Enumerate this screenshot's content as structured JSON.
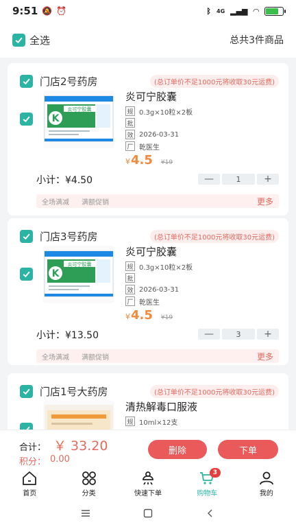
{
  "status": {
    "time": "9:51",
    "network": "4G",
    "battery_level": 0.75
  },
  "select_bar": {
    "label": "全选",
    "total": "总共3件商品"
  },
  "stores": [
    {
      "name": "门店2号药房",
      "freight_note": "(总订单价不足1000元将收取30元运费)",
      "product": {
        "name": "炎可宁胶囊",
        "spec_tag": "规",
        "spec": "0.3g×10粒×2板",
        "approval_tag": "批",
        "approval": "",
        "expiry_tag": "效",
        "expiry": "2026-03-31",
        "maker_tag": "厂",
        "maker": "乾医生",
        "price_symbol": "¥",
        "price": "4.5",
        "original_price": "¥19",
        "box_title": "炎可宁胶囊",
        "box_letter": "K"
      },
      "subtotal": "小计：¥4.50",
      "quantity": "1",
      "promos": [
        "全场满减",
        "满额促销"
      ],
      "more": "更多"
    },
    {
      "name": "门店3号药房",
      "freight_note": "(总订单价不足1000元将收取30元运费)",
      "product": {
        "name": "炎可宁胶囊",
        "spec_tag": "规",
        "spec": "0.3g×10粒×2板",
        "approval_tag": "批",
        "approval": "",
        "expiry_tag": "效",
        "expiry": "2026-03-31",
        "maker_tag": "厂",
        "maker": "乾医生",
        "price_symbol": "¥",
        "price": "4.5",
        "original_price": "¥19",
        "box_title": "炎可宁胶囊",
        "box_letter": "K"
      },
      "subtotal": "小计：¥13.50",
      "quantity": "3",
      "promos": [
        "全场满减",
        "满额促销"
      ],
      "more": "更多"
    },
    {
      "name": "门店1号大药房",
      "freight_note": "(总订单价不足1000元将收取30元运费)",
      "product": {
        "name": "清热解毒口服液",
        "spec_tag": "规",
        "spec": "10ml×12支"
      }
    }
  ],
  "checkout": {
    "sum_label": "合计：",
    "sum_value": "￥ 33.20",
    "points_label": "积分：",
    "points_value": "0.00",
    "delete_label": "删除",
    "order_label": "下单"
  },
  "tabs": [
    {
      "label": "首页",
      "icon": "home-icon"
    },
    {
      "label": "分类",
      "icon": "category-icon"
    },
    {
      "label": "快速下单",
      "icon": "quick-order-icon"
    },
    {
      "label": "购物车",
      "icon": "cart-icon",
      "badge": "3",
      "active": true
    },
    {
      "label": "我的",
      "icon": "profile-icon"
    }
  ],
  "colors": {
    "accent": "#2bb3a3",
    "price": "#f08a3e",
    "alert": "#eb5a5a"
  }
}
